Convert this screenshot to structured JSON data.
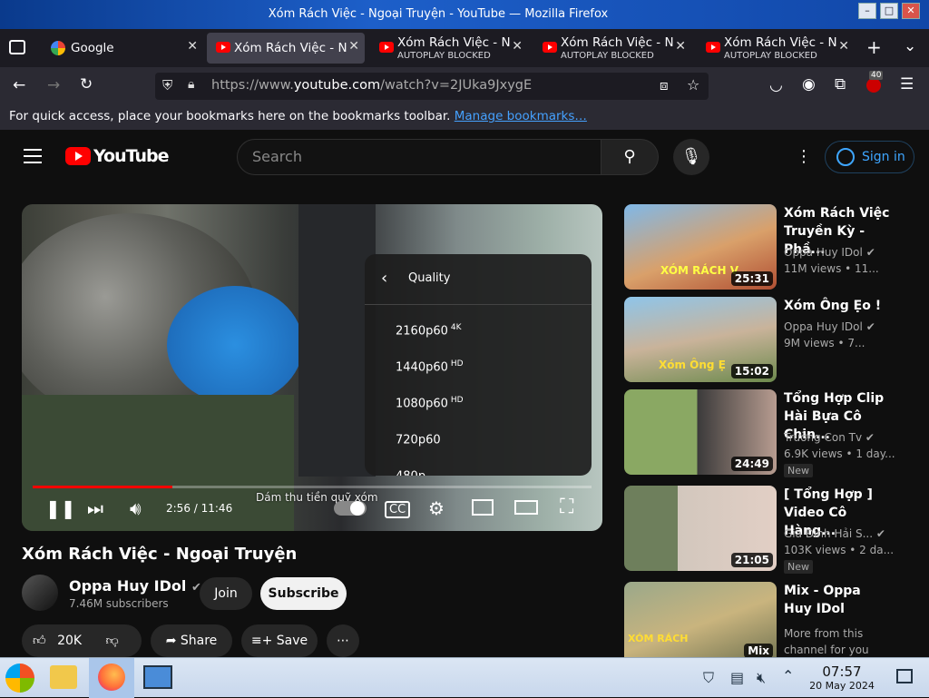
{
  "window": {
    "title": "Xóm Rách Việc - Ngoại Truyện - YouTube — Mozilla Firefox"
  },
  "tabs": [
    {
      "title": "Google",
      "subtitle": ""
    },
    {
      "title": "Xóm Rách Việc - N",
      "subtitle": ""
    },
    {
      "title": "Xóm Rách Việc - N",
      "subtitle": "AUTOPLAY BLOCKED"
    },
    {
      "title": "Xóm Rách Việc - N",
      "subtitle": "AUTOPLAY BLOCKED"
    },
    {
      "title": "Xóm Rách Việc - N",
      "subtitle": "AUTOPLAY BLOCKED"
    }
  ],
  "navbar": {
    "url_prefix": "https://www.",
    "url_domain": "youtube.com",
    "url_path": "/watch?v=2JUka9JxygE",
    "extensions_badge": "40"
  },
  "bookmarks": {
    "text": "For quick access, place your bookmarks here on the bookmarks toolbar.",
    "link": "Manage bookmarks…"
  },
  "youtube": {
    "logo": "YouTube",
    "search_placeholder": "Search",
    "signin": "Sign in"
  },
  "player": {
    "quality_title": "Quality",
    "quality_options": [
      {
        "label": "2160p60",
        "badge": "4K"
      },
      {
        "label": "1440p60",
        "badge": "HD"
      },
      {
        "label": "1080p60",
        "badge": "HD"
      },
      {
        "label": "720p60",
        "badge": ""
      },
      {
        "label": "480p",
        "badge": ""
      }
    ],
    "time": "2:56 / 11:46",
    "progress": 0.25,
    "caption": "Dám thu tiền quỹ xóm"
  },
  "video": {
    "title": "Xóm Rách Việc - Ngoại Truyện",
    "channel": "Oppa Huy IDol",
    "subscribers": "7.46M subscribers",
    "join": "Join",
    "subscribe": "Subscribe",
    "likes": "20K",
    "share": "Share",
    "save": "Save"
  },
  "recommendations": [
    {
      "title": "Xóm Rách Việc Truyền Kỳ - Phầ...",
      "channel": "Oppa Huy IDol",
      "meta": "11M views • 11...",
      "duration": "25:31",
      "badge": "",
      "thumb_text": "XÓM RÁCH V"
    },
    {
      "title": "Xóm Ông Ẹo !",
      "channel": "Oppa Huy IDol",
      "meta": "9M views • 7...",
      "duration": "15:02",
      "badge": "",
      "thumb_text": "Xóm Ông Ẹ"
    },
    {
      "title": "Tổng Hợp Clip Hài Bựa Cô Chin...",
      "channel": "Trường Con Tv",
      "meta": "6.9K views • 1 day...",
      "duration": "24:49",
      "badge": "New",
      "thumb_text": ""
    },
    {
      "title": "[ Tổng Hợp ] Video Cô Hàng...",
      "channel": "Gia Đình Hải S...",
      "meta": "103K views • 2 da...",
      "duration": "21:05",
      "badge": "New",
      "thumb_text": ""
    },
    {
      "title": "Mix - Oppa Huy IDol",
      "channel": "More from this",
      "meta": "channel for you",
      "duration": "Mix",
      "badge": "",
      "thumb_text": "XÓM RÁCH"
    }
  ],
  "taskbar": {
    "time": "07:57",
    "date": "20 May 2024"
  }
}
